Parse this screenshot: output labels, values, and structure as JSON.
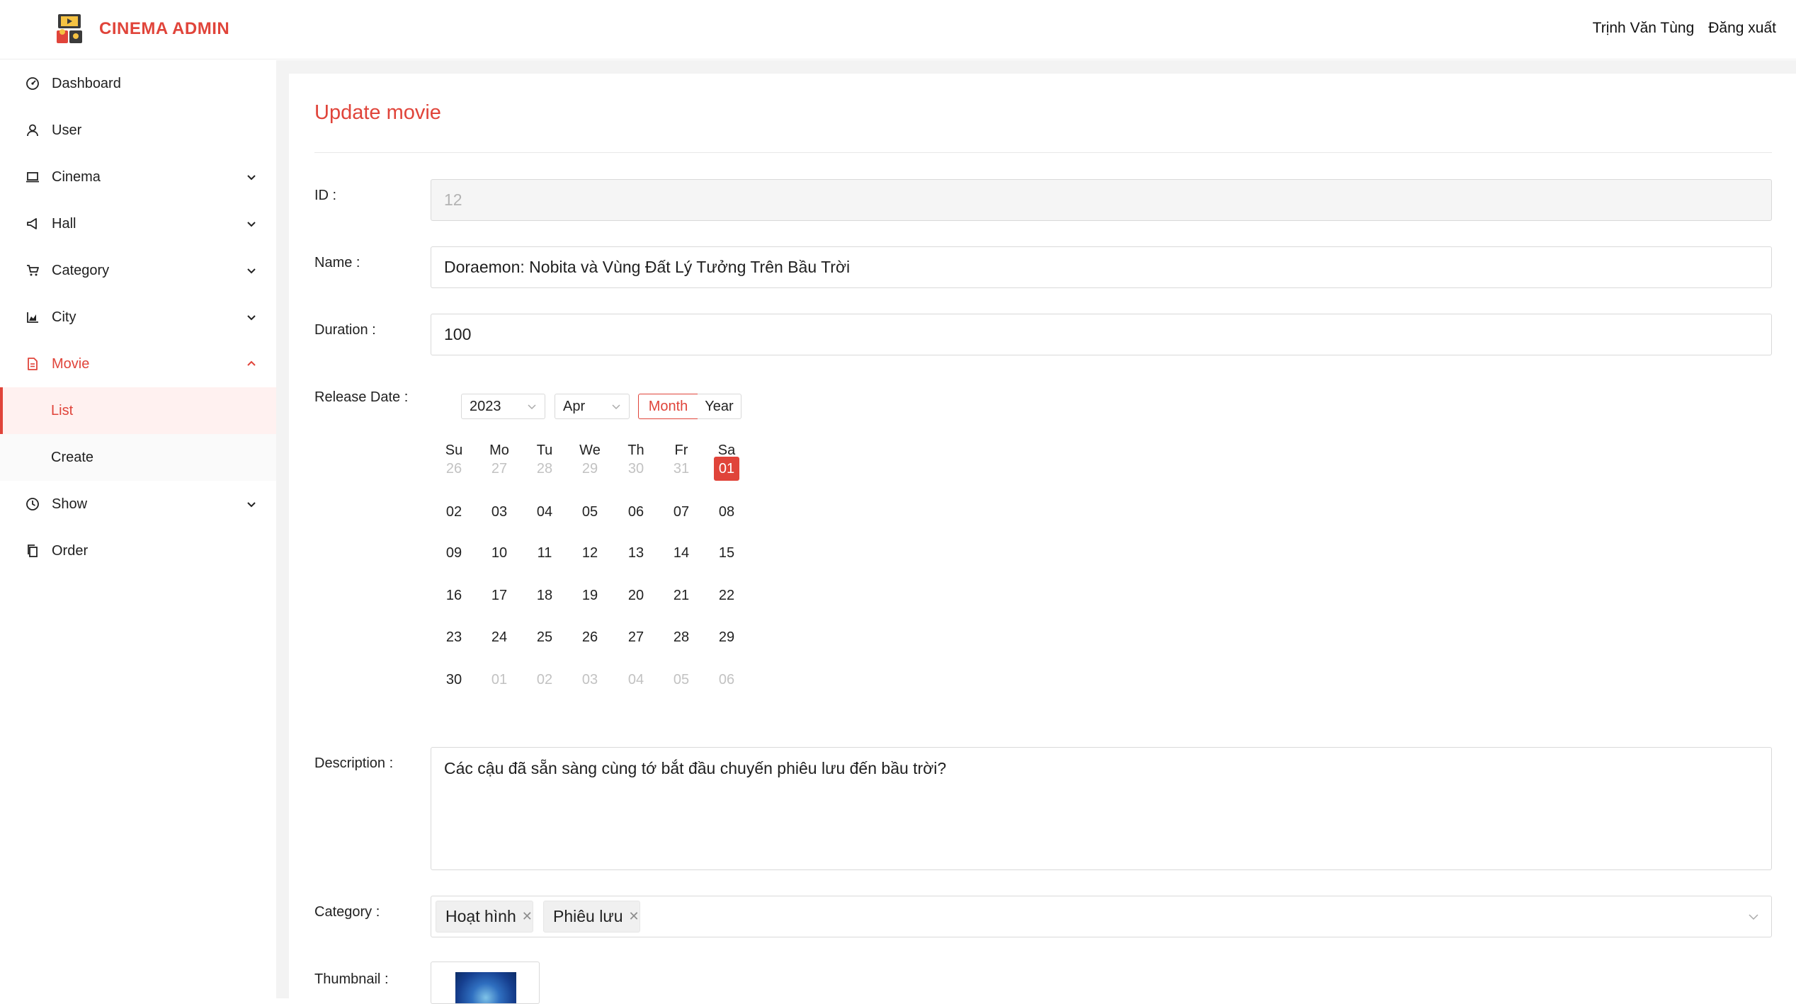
{
  "app": {
    "name": "CINEMA ADMIN"
  },
  "header": {
    "user_name": "Trịnh Văn Tùng",
    "logout_label": "Đăng xuất"
  },
  "sidebar": {
    "items": [
      {
        "label": "Dashboard",
        "icon": "dashboard-icon"
      },
      {
        "label": "User",
        "icon": "user-icon"
      },
      {
        "label": "Cinema",
        "icon": "laptop-icon"
      },
      {
        "label": "Hall",
        "icon": "megaphone-icon"
      },
      {
        "label": "Category",
        "icon": "cart-icon"
      },
      {
        "label": "City",
        "icon": "area-chart-icon"
      },
      {
        "label": "Movie",
        "icon": "file-icon"
      },
      {
        "label": "Show",
        "icon": "clock-icon"
      },
      {
        "label": "Order",
        "icon": "copy-icon"
      }
    ],
    "movie_sub": [
      {
        "label": "List"
      },
      {
        "label": "Create"
      }
    ]
  },
  "form": {
    "title": "Update movie",
    "id_label": "ID",
    "id_value": "12",
    "name_label": "Name",
    "name_value": "Doraemon: Nobita và Vùng Đất Lý Tưởng Trên Bầu Trời",
    "duration_label": "Duration",
    "duration_value": "100",
    "release_label": "Release Date",
    "description_label": "Description",
    "description_value": "Các cậu đã sẵn sàng cùng tớ bắt đầu chuyến phiêu lưu đến bầu trời?",
    "category_label": "Category",
    "category_tags": [
      "Hoạt hình",
      "Phiêu lưu"
    ],
    "thumbnail_label": "Thumbnail"
  },
  "calendar": {
    "year": "2023",
    "month": "Apr",
    "mode_month": "Month",
    "mode_year": "Year",
    "weekdays": [
      "Su",
      "Mo",
      "Tu",
      "We",
      "Th",
      "Fr",
      "Sa"
    ],
    "weeks": [
      [
        "26",
        "27",
        "28",
        "29",
        "30",
        "31",
        "01"
      ],
      [
        "02",
        "03",
        "04",
        "05",
        "06",
        "07",
        "08"
      ],
      [
        "09",
        "10",
        "11",
        "12",
        "13",
        "14",
        "15"
      ],
      [
        "16",
        "17",
        "18",
        "19",
        "20",
        "21",
        "22"
      ],
      [
        "23",
        "24",
        "25",
        "26",
        "27",
        "28",
        "29"
      ],
      [
        "30",
        "01",
        "02",
        "03",
        "04",
        "05",
        "06"
      ]
    ],
    "selected": "01",
    "accent": "#e0443a"
  }
}
